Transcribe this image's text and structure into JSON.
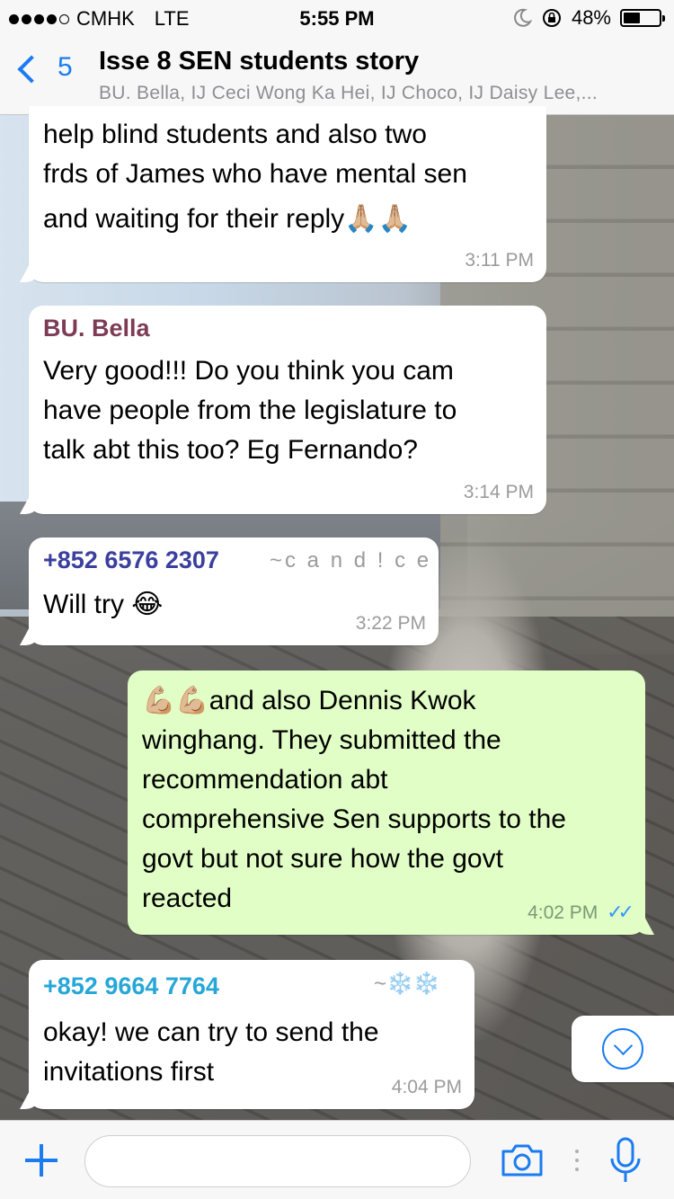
{
  "status_bar": {
    "carrier": "CMHK",
    "network": "LTE",
    "time": "5:55 PM",
    "battery": "48%",
    "battery_level": 0.48,
    "icons": [
      "moon-icon",
      "rotation-lock-icon",
      "battery-icon"
    ]
  },
  "header": {
    "back_count": "5",
    "title": "Isse 8 SEN students story",
    "subtitle": "BU. Bella, IJ Ceci Wong Ka Hei, IJ Choco, IJ Daisy Lee,..."
  },
  "messages": [
    {
      "direction": "in",
      "lines": [
        "help blind students and also two",
        "frds of James who have mental sen",
        "and waiting for their reply🙏🏼🙏🏼"
      ],
      "time": "3:11 PM"
    },
    {
      "direction": "in",
      "sender": "BU. Bella",
      "sender_color": "#7d3b56",
      "lines": [
        "Very good!!! Do you think you cam",
        "have people from the legislature to",
        "talk abt this too? Eg Fernando?"
      ],
      "time": "3:14 PM"
    },
    {
      "direction": "in",
      "sender": "+852 6576 2307",
      "sender_color": "#3b3f9e",
      "nickname": "~c a n d ! c e",
      "lines": [
        "Will try 😂"
      ],
      "time": "3:22 PM"
    },
    {
      "direction": "out",
      "lines": [
        "💪🏼💪🏼and also Dennis Kwok",
        "winghang. They submitted the",
        "recommendation abt",
        "comprehensive Sen supports to the",
        "govt but not sure how the govt",
        "reacted"
      ],
      "time": "4:02 PM",
      "status": "read"
    },
    {
      "direction": "in",
      "sender": "+852 9664 7764",
      "sender_color": "#27a7d8",
      "nickname": "~❄️❄️",
      "lines": [
        "okay! we can try to send the",
        "invitations first"
      ],
      "time": "4:04 PM"
    }
  ],
  "input": {
    "placeholder": ""
  },
  "colors": {
    "accent": "#1a7cf0",
    "outgoing_bubble": "#e1fec6",
    "incoming_bubble": "#ffffff"
  }
}
